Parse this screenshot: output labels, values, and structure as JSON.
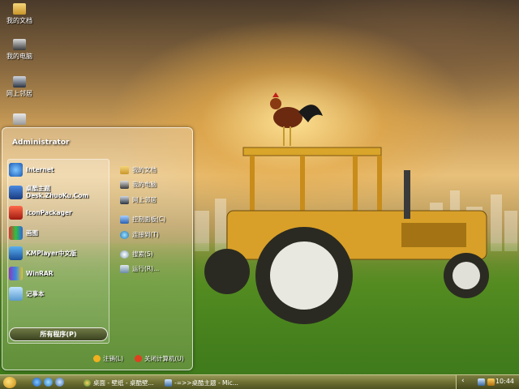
{
  "desktop": {
    "icons": [
      {
        "label": "我的文档",
        "icon": "folder-icon"
      },
      {
        "label": "我的电脑",
        "icon": "computer-icon"
      },
      {
        "label": "网上邻居",
        "icon": "network-icon"
      },
      {
        "label": "",
        "icon": "recycle-bin-icon"
      }
    ]
  },
  "start_menu": {
    "user": "Administrator",
    "pinned": [
      {
        "label": "Internet",
        "icon": "internet-explorer-icon"
      },
      {
        "label": "桌酷主题",
        "sublabel": "Desk.ZhuoKu.Com",
        "icon": "zhuoku-icon"
      },
      {
        "label": "IconPackager",
        "icon": "iconpackager-icon"
      },
      {
        "label": "画图",
        "icon": "paint-icon"
      },
      {
        "label": "KMPlayer中文版",
        "icon": "kmplayer-icon"
      },
      {
        "label": "WinRAR",
        "icon": "winrar-icon"
      },
      {
        "label": "记事本",
        "icon": "notepad-icon"
      }
    ],
    "all_programs": "所有程序(P)",
    "right": [
      {
        "label": "我的文档",
        "icon": "documents-icon"
      },
      {
        "label": "我的电脑",
        "icon": "computer-icon"
      },
      {
        "label": "网上邻居",
        "icon": "network-icon"
      },
      {
        "label": "控制面板(C)",
        "icon": "control-panel-icon"
      },
      {
        "label": "连接到(T)",
        "icon": "connect-icon"
      },
      {
        "label": "搜索(S)",
        "icon": "search-icon"
      },
      {
        "label": "运行(R)...",
        "icon": "run-icon"
      }
    ],
    "logoff": "注销(L)",
    "shutdown": "关闭计算机(U)"
  },
  "taskbar": {
    "tasks": [
      {
        "label": "桌面 - 壁纸 - 桌酷壁...",
        "icon": "browser-icon"
      },
      {
        "label": "-=>>桌酷主题 - Mic...",
        "icon": "window-icon"
      }
    ],
    "clock": "10:44"
  },
  "colors": {
    "taskbar": "#6e7032",
    "accent": "#c98a10"
  }
}
